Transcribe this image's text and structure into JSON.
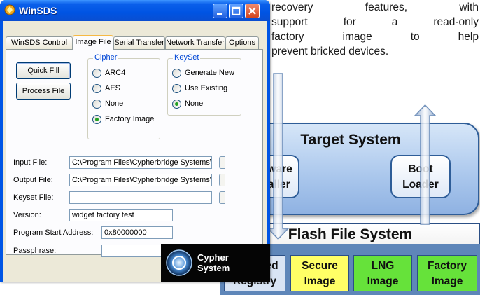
{
  "window": {
    "title": "WinSDS",
    "tabs": [
      "WinSDS Control",
      "Image File",
      "Serial Transfer",
      "Network Transfer",
      "Options"
    ],
    "active_tab": "Image File"
  },
  "buttons": {
    "quick_fill": "Quick Fill",
    "process_file": "Process File"
  },
  "cipher": {
    "label": "Cipher",
    "options": [
      "ARC4",
      "AES",
      "None",
      "Factory Image"
    ],
    "selected": "Factory Image"
  },
  "keyset": {
    "label": "KeySet",
    "options": [
      "Generate New",
      "Use Existing",
      "None"
    ],
    "selected": "None"
  },
  "fields": {
    "input_file": {
      "label": "Input File:",
      "value": "C:\\Program Files\\Cypherbridge Systems\\Win"
    },
    "output_file": {
      "label": "Output File:",
      "value": "C:\\Program Files\\Cypherbridge Systems\\Win"
    },
    "keyset_file": {
      "label": "Keyset File:",
      "value": ""
    },
    "version": {
      "label": "Version:",
      "value": "widget factory test"
    },
    "program_start": {
      "label": "Program Start Address:",
      "value": "0x80000000"
    },
    "passphrase": {
      "label": "Passphrase:",
      "value": ""
    }
  },
  "logo": {
    "line1": "Cypher",
    "line2": "System"
  },
  "paragraph": {
    "line1_words": [
      "recovery",
      "features,",
      "with"
    ],
    "line2_words": [
      "support",
      "for",
      "a",
      "read-only"
    ],
    "line3_words": [
      "factory",
      "image",
      "to",
      "help"
    ],
    "line4": "prevent bricked devices."
  },
  "diagram": {
    "target_system": "Target System",
    "software_installer": [
      "Software",
      "Installer"
    ],
    "boot_loader": [
      "Boot",
      "Loader"
    ],
    "flash_file_system": "Flash File System",
    "cells": [
      {
        "line1": "Managed",
        "line2": "Registry",
        "color": "#d9e4f4"
      },
      {
        "line1": "Secure",
        "line2": "Image",
        "color": "#ffff66"
      },
      {
        "line1": "LNG",
        "line2": "Image",
        "color": "#66e23a"
      },
      {
        "line1": "Factory",
        "line2": "Image",
        "color": "#66e23a"
      }
    ]
  }
}
